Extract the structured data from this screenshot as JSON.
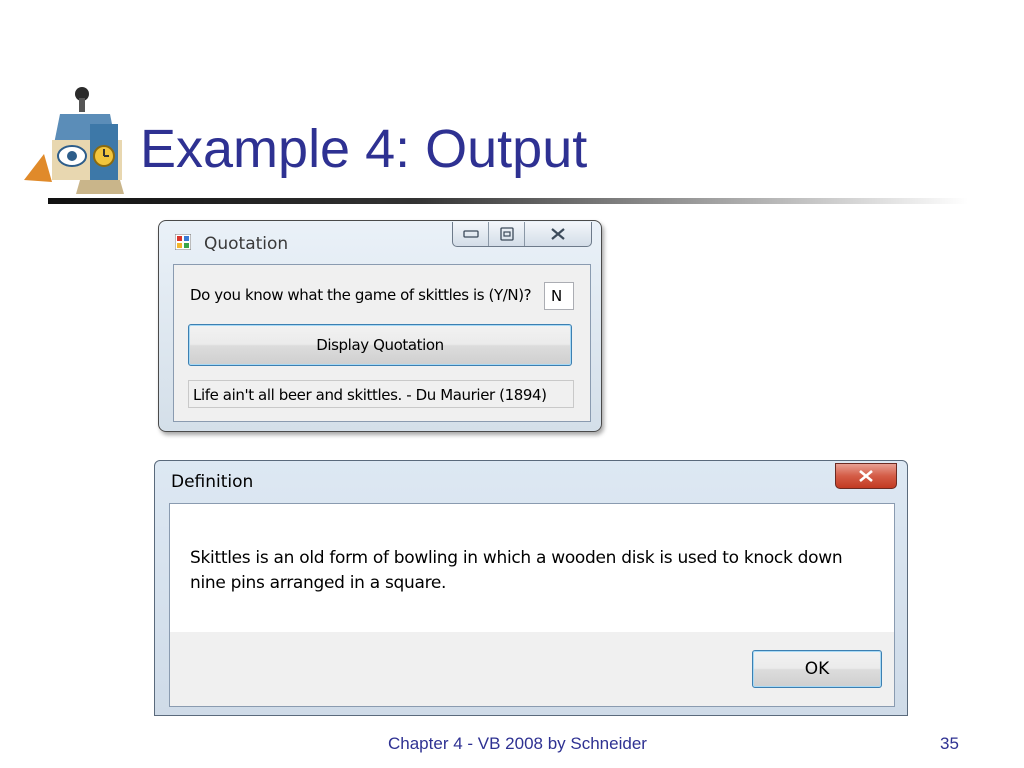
{
  "slide": {
    "title": "Example 4: Output",
    "footer": "Chapter 4 - VB 2008 by Schneider",
    "page_number": "35"
  },
  "quotation_window": {
    "title": "Quotation",
    "question_label": "Do you know what the game of skittles is (Y/N)?",
    "answer_value": "N",
    "display_button_label": "Display Quotation",
    "output_text": "Life ain't all beer and skittles. - Du Maurier (1894)"
  },
  "definition_dialog": {
    "title": "Definition",
    "message_line1": "Skittles is an old form of bowling in which a wooden disk is used to knock down",
    "message_line2": "nine pins arranged in a square.",
    "ok_label": "OK"
  },
  "colors": {
    "title_text": "#2e3192",
    "button_border": "#3c7fb1",
    "close_button": "#c23a22"
  }
}
